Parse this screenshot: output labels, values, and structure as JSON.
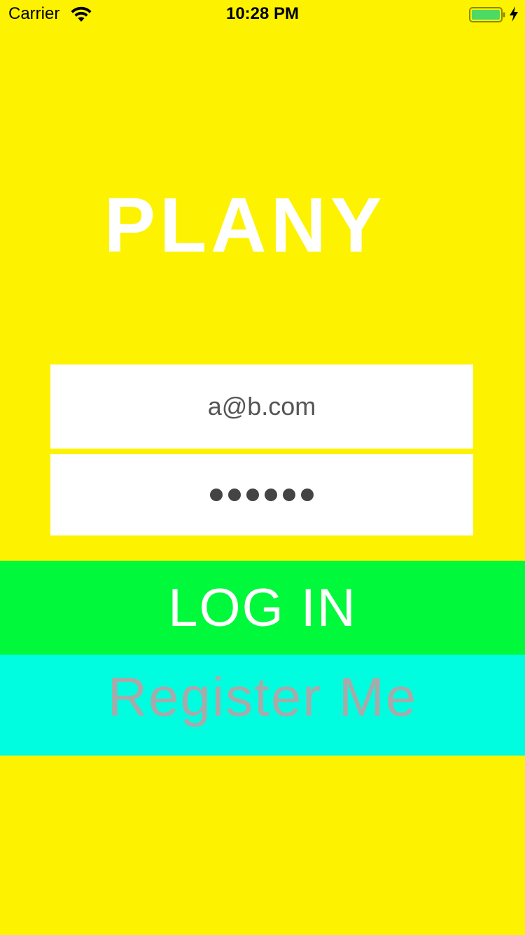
{
  "status_bar": {
    "carrier": "Carrier",
    "time": "10:28 PM",
    "wifi_icon": "wifi-icon",
    "battery_icon": "battery-icon",
    "charging_icon": "charging-bolt-icon",
    "battery_level": 1.0
  },
  "app": {
    "title": "PLANY"
  },
  "login_form": {
    "email_value": "a@b.com",
    "password_mask": "••••••",
    "password_length": 6
  },
  "buttons": {
    "login_label": "LOG IN",
    "register_label": "Register Me"
  },
  "colors": {
    "background": "#fdf200",
    "login_button": "#00f93a",
    "register_button": "#00fde0",
    "field_background": "#ffffff",
    "title_text": "#ffffff",
    "register_text": "#a9a9a9",
    "battery_fill": "#4cd964"
  }
}
